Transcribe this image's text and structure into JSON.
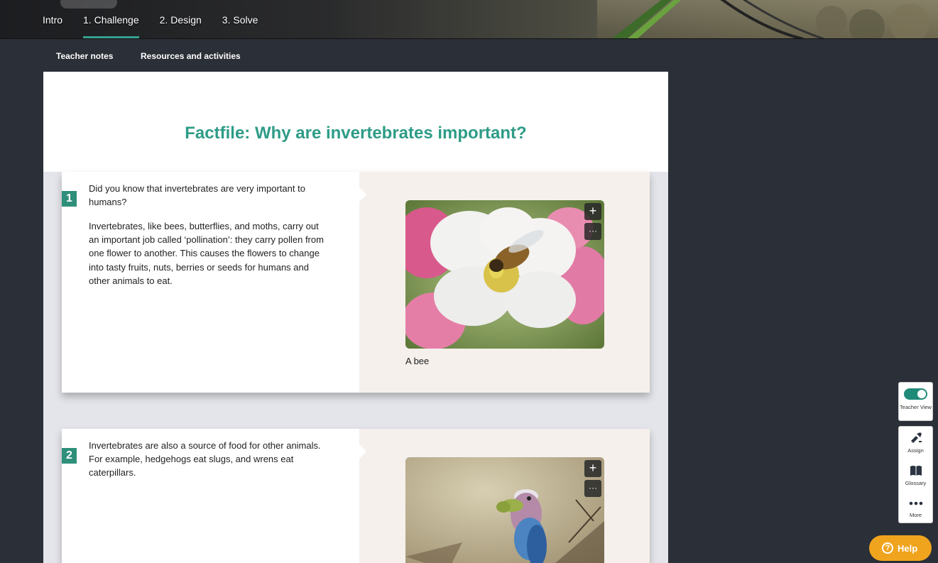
{
  "nav": {
    "tabs": [
      {
        "label": "Intro",
        "active": false
      },
      {
        "label": "1. Challenge",
        "active": true
      },
      {
        "label": "2. Design",
        "active": false
      },
      {
        "label": "3. Solve",
        "active": false
      }
    ],
    "accent_color": "#35a28f"
  },
  "subnav": {
    "teacher_notes": "Teacher notes",
    "resources": "Resources and activities"
  },
  "page": {
    "title": "Factfile: Why are invertebrates important?"
  },
  "sections": [
    {
      "number": "1",
      "paragraphs": [
        "Did you know that invertebrates are very important to humans?",
        "Invertebrates, like bees, butterflies, and moths, carry out an important job called ‘pollination’: they carry pollen from one flower to another. This causes the flowers to change into tasty fruits, nuts, berries or seeds for humans and other animals to eat."
      ],
      "image_caption": "A bee"
    },
    {
      "number": "2",
      "paragraphs": [
        "Invertebrates are also a source of food for other animals. For example, hedgehogs eat slugs, and wrens eat caterpillars."
      ]
    }
  ],
  "image_buttons": {
    "zoom": "+",
    "more": "···"
  },
  "toolbar": {
    "teacher_view_label": "Teacher View",
    "teacher_view_on": true,
    "assign_label": "Assign",
    "glossary_label": "Glossary",
    "more_label": "More"
  },
  "help": {
    "label": "Help",
    "icon": "?"
  }
}
